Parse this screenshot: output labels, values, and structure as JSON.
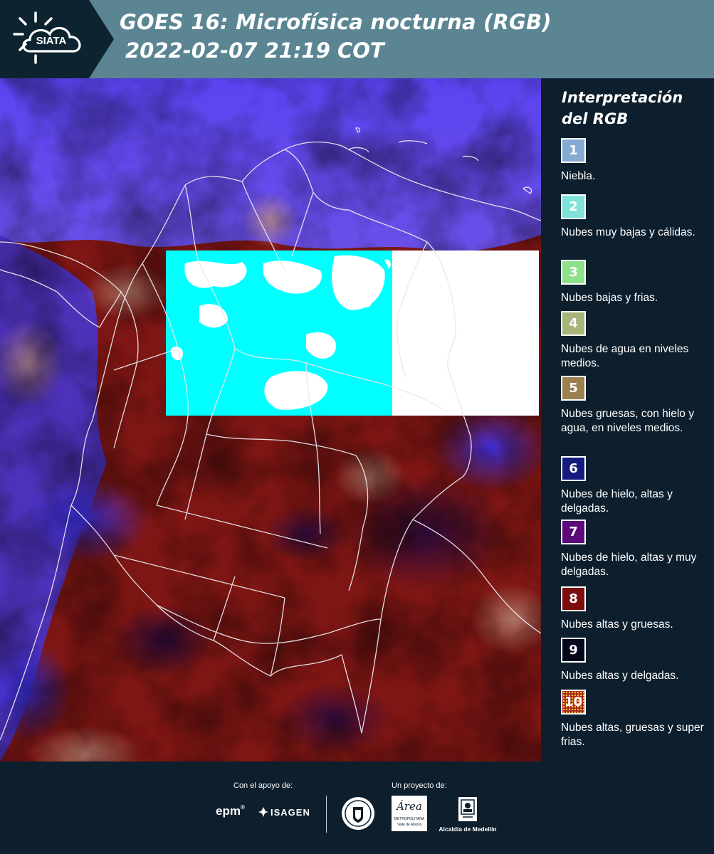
{
  "header": {
    "title_line1": "GOES 16: Microfísica nocturna (RGB)",
    "title_line2": "2022-02-07 21:19 COT",
    "logo_text": "SIATA",
    "background_color": "#5b8592"
  },
  "legend": {
    "title": "Interpretación del RGB",
    "items": [
      {
        "number": "1",
        "color": "#86abd2",
        "label": "Niebla."
      },
      {
        "number": "2",
        "color": "#7fe3d9",
        "label": "Nubes muy bajas y cálidas."
      },
      {
        "number": "3",
        "color": "#8fe08a",
        "label": "Nubes bajas y frias."
      },
      {
        "number": "4",
        "color": "#a8b57a",
        "label": "Nubes de agua en niveles medios."
      },
      {
        "number": "5",
        "color": "#9c804f",
        "label": "Nubes gruesas, con hielo y agua, en niveles medios."
      },
      {
        "number": "6",
        "color": "#151a7e",
        "label": "Nubes de hielo, altas y delgadas."
      },
      {
        "number": "7",
        "color": "#5c0a7a",
        "label": "Nubes de hielo, altas y muy delgadas."
      },
      {
        "number": "8",
        "color": "#7c0e0e",
        "label": "Nubes altas y gruesas."
      },
      {
        "number": "9",
        "color": "#05061a",
        "label": "Nubes altas y delgadas."
      },
      {
        "number": "10",
        "color": "#a8221a",
        "label": "Nubes altas, gruesas y super frias."
      }
    ]
  },
  "footer": {
    "support_caption": "Con el apoyo de:",
    "project_caption": "Un proyecto de:",
    "sponsor_epm": "epm",
    "sponsor_isagen": "ISAGEN",
    "area_text": "Área",
    "area_subtitle": "METROPOLITANA",
    "area_subtitle2": "Valle de Aburrá",
    "alcaldia_text": "Alcaldía de Medellín"
  },
  "map": {
    "no_data_colors": [
      "#00ffff",
      "#ffffff"
    ]
  }
}
